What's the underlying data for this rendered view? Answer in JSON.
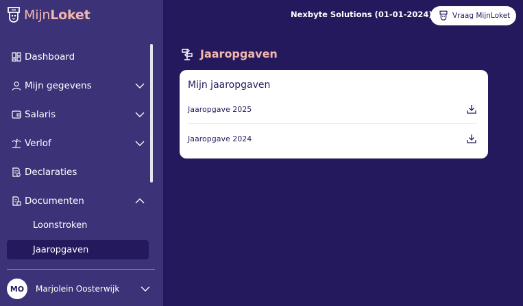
{
  "brand": {
    "name_light": "Mijn",
    "name_bold": "Loket"
  },
  "sidebar": {
    "items": [
      {
        "label": "Dashboard"
      },
      {
        "label": "Mijn gegevens"
      },
      {
        "label": "Salaris"
      },
      {
        "label": "Verlof"
      },
      {
        "label": "Declaraties"
      },
      {
        "label": "Documenten"
      }
    ],
    "sub_items": [
      {
        "label": "Loonstroken"
      },
      {
        "label": "Jaaropgaven"
      }
    ]
  },
  "user": {
    "initials": "MO",
    "name": "Marjolein Oosterwijk"
  },
  "topbar": {
    "company": "Nexbyte Solutions (01-01-2024)",
    "ask_button": "Vraag MijnLoket"
  },
  "page": {
    "title": "Jaaropgaven",
    "card_title": "Mijn jaaropgaven",
    "rows": [
      {
        "label": "Jaaropgave 2025"
      },
      {
        "label": "Jaaropgave 2024"
      }
    ]
  },
  "colors": {
    "background": "#24195c",
    "sidebar": "#3c3278",
    "accent": "#f1b7ad",
    "card": "#ffffff"
  }
}
